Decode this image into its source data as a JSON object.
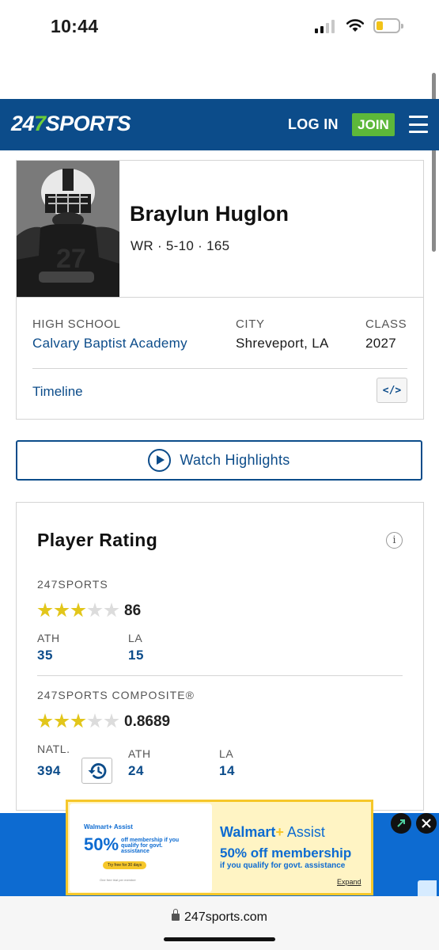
{
  "status": {
    "time": "10:44"
  },
  "header": {
    "logo_num": "24",
    "logo_seven": "7",
    "logo_text": "SPORTS",
    "login_label": "LOG IN",
    "join_label": "JOIN"
  },
  "player": {
    "name": "Braylun Huglon",
    "meta": "WR · 5-10 · 165",
    "high_school_label": "HIGH SCHOOL",
    "high_school": "Calvary Baptist Academy",
    "city_label": "CITY",
    "city": "Shreveport, LA",
    "class_label": "CLASS",
    "class": "2027",
    "timeline_label": "Timeline",
    "embed_label": "</>"
  },
  "highlights": {
    "label": "Watch Highlights"
  },
  "rating": {
    "title": "Player Rating",
    "info_icon": "i",
    "s247": {
      "label": "247SPORTS",
      "stars": 3,
      "score": "86",
      "ranks": [
        {
          "label": "ATH",
          "value": "35"
        },
        {
          "label": "LA",
          "value": "15"
        }
      ]
    },
    "composite": {
      "label": "247SPORTS COMPOSITE®",
      "stars": 3,
      "score": "0.8689",
      "ranks": [
        {
          "label": "NATL.",
          "value": "394"
        },
        {
          "label": "ATH",
          "value": "24"
        },
        {
          "label": "LA",
          "value": "14"
        }
      ]
    }
  },
  "ad": {
    "mini_brand": "Walmart+ Assist",
    "mini_pct": "50%",
    "mini_text": "off membership if you qualify for govt. assistance",
    "mini_cta": "Try free for 30 days",
    "mini_fine": "One free trial per member",
    "brand_walmart": "Walmart",
    "brand_plus": "+",
    "brand_assist": " Assist",
    "headline": "50% off membership",
    "subline": "if you qualify for govt. assistance",
    "expand_label": "Expand"
  },
  "browser": {
    "url": "247sports.com"
  },
  "colors": {
    "brand_blue": "#0c4c8a",
    "brand_green": "#5db83a",
    "star_gold": "#e2c61b"
  }
}
